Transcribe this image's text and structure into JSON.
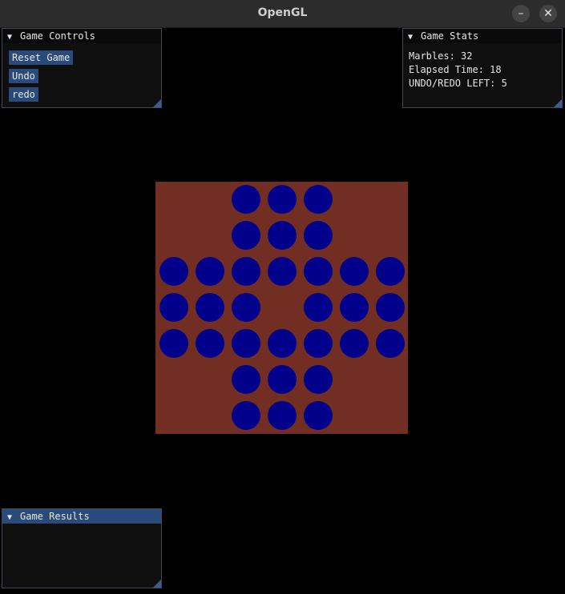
{
  "window": {
    "title": "OpenGL",
    "minimize_icon": "–",
    "close_icon": "✕"
  },
  "controls": {
    "title": "Game Controls",
    "reset_label": "Reset Game",
    "undo_label": "Undo",
    "redo_label": "redo"
  },
  "stats": {
    "title": "Game Stats",
    "marbles": "Marbles: 32",
    "elapsed": "Elapsed Time: 18",
    "undo_redo": "UNDO/REDO LEFT: 5"
  },
  "results": {
    "title": "Game Results"
  },
  "board": {
    "colors": {
      "board": "#722e22",
      "marble": "#00008a"
    },
    "grid": [
      [
        -1,
        -1,
        1,
        1,
        1,
        -1,
        -1
      ],
      [
        -1,
        -1,
        1,
        1,
        1,
        -1,
        -1
      ],
      [
        1,
        1,
        1,
        1,
        1,
        1,
        1
      ],
      [
        1,
        1,
        1,
        0,
        1,
        1,
        1
      ],
      [
        1,
        1,
        1,
        1,
        1,
        1,
        1
      ],
      [
        -1,
        -1,
        1,
        1,
        1,
        -1,
        -1
      ],
      [
        -1,
        -1,
        1,
        1,
        1,
        -1,
        -1
      ]
    ]
  }
}
